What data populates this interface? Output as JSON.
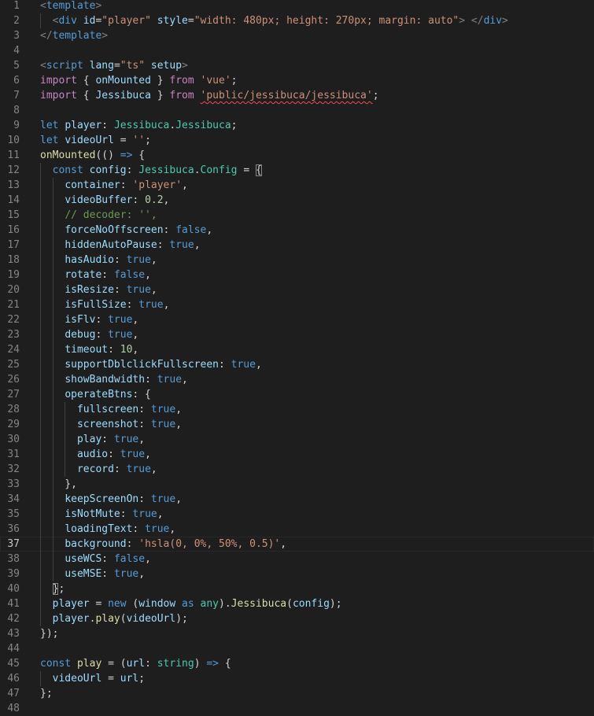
{
  "editor": {
    "current_line": 37,
    "colors": {
      "background": "#1e1e1e",
      "line_number": "#858585",
      "keyword": "#569cd6",
      "control": "#c586c0",
      "function": "#dcdcaa",
      "type": "#4ec9b0",
      "variable": "#9cdcfe",
      "string": "#ce9178",
      "number": "#b5cea8",
      "comment": "#6a9955"
    },
    "lines": [
      {
        "n": "1",
        "indent": 0,
        "tokens": [
          [
            "ang",
            "<"
          ],
          [
            "tag",
            "template"
          ],
          [
            "ang",
            ">"
          ]
        ]
      },
      {
        "n": "2",
        "indent": 1,
        "tokens": [
          [
            "txt",
            "  "
          ],
          [
            "ang",
            "<"
          ],
          [
            "tag",
            "div"
          ],
          [
            "txt",
            " "
          ],
          [
            "attr",
            "id"
          ],
          [
            "txt",
            "="
          ],
          [
            "str",
            "\"player\""
          ],
          [
            "txt",
            " "
          ],
          [
            "attr",
            "style"
          ],
          [
            "txt",
            "="
          ],
          [
            "str",
            "\"width: 480px; height: 270px; margin: auto\""
          ],
          [
            "ang",
            ">"
          ],
          [
            "txt",
            " "
          ],
          [
            "ang",
            "</"
          ],
          [
            "tag",
            "div"
          ],
          [
            "ang",
            ">"
          ]
        ]
      },
      {
        "n": "3",
        "indent": 0,
        "tokens": [
          [
            "ang",
            "</"
          ],
          [
            "tag",
            "template"
          ],
          [
            "ang",
            ">"
          ]
        ]
      },
      {
        "n": "4",
        "indent": 0,
        "tokens": []
      },
      {
        "n": "5",
        "indent": 0,
        "tokens": [
          [
            "ang",
            "<"
          ],
          [
            "tag",
            "script"
          ],
          [
            "txt",
            " "
          ],
          [
            "attr",
            "lang"
          ],
          [
            "txt",
            "="
          ],
          [
            "str",
            "\"ts\""
          ],
          [
            "txt",
            " "
          ],
          [
            "attr",
            "setup"
          ],
          [
            "ang",
            ">"
          ]
        ]
      },
      {
        "n": "6",
        "indent": 0,
        "tokens": [
          [
            "ctl",
            "import"
          ],
          [
            "txt",
            " { "
          ],
          [
            "var",
            "onMounted"
          ],
          [
            "txt",
            " } "
          ],
          [
            "ctl",
            "from"
          ],
          [
            "txt",
            " "
          ],
          [
            "str",
            "'vue'"
          ],
          [
            "txt",
            ";"
          ]
        ]
      },
      {
        "n": "7",
        "indent": 0,
        "tokens": [
          [
            "ctl",
            "import"
          ],
          [
            "txt",
            " { "
          ],
          [
            "var",
            "Jessibuca"
          ],
          [
            "txt",
            " } "
          ],
          [
            "ctl",
            "from"
          ],
          [
            "txt",
            " "
          ],
          [
            "strsq",
            "'public/jessibuca/jessibuca'"
          ],
          [
            "txt",
            ";"
          ]
        ]
      },
      {
        "n": "8",
        "indent": 0,
        "tokens": []
      },
      {
        "n": "9",
        "indent": 0,
        "tokens": [
          [
            "kw",
            "let"
          ],
          [
            "txt",
            " "
          ],
          [
            "var",
            "player"
          ],
          [
            "txt",
            ": "
          ],
          [
            "type",
            "Jessibuca"
          ],
          [
            "txt",
            "."
          ],
          [
            "type",
            "Jessibuca"
          ],
          [
            "txt",
            ";"
          ]
        ]
      },
      {
        "n": "10",
        "indent": 0,
        "tokens": [
          [
            "kw",
            "let"
          ],
          [
            "txt",
            " "
          ],
          [
            "var",
            "videoUrl"
          ],
          [
            "txt",
            " = "
          ],
          [
            "str",
            "''"
          ],
          [
            "txt",
            ";"
          ]
        ]
      },
      {
        "n": "11",
        "indent": 0,
        "tokens": [
          [
            "fn",
            "onMounted"
          ],
          [
            "txt",
            "(() "
          ],
          [
            "kw",
            "=>"
          ],
          [
            "txt",
            " {"
          ]
        ]
      },
      {
        "n": "12",
        "indent": 1,
        "tokens": [
          [
            "txt",
            "  "
          ],
          [
            "kw",
            "const"
          ],
          [
            "txt",
            " "
          ],
          [
            "var",
            "config"
          ],
          [
            "txt",
            ": "
          ],
          [
            "type",
            "Jessibuca"
          ],
          [
            "txt",
            "."
          ],
          [
            "type",
            "Config"
          ],
          [
            "txt",
            " = "
          ],
          [
            "bkt",
            "{"
          ]
        ]
      },
      {
        "n": "13",
        "indent": 2,
        "tokens": [
          [
            "txt",
            "    "
          ],
          [
            "var",
            "container"
          ],
          [
            "txt",
            ": "
          ],
          [
            "str",
            "'player'"
          ],
          [
            "txt",
            ","
          ]
        ]
      },
      {
        "n": "14",
        "indent": 2,
        "tokens": [
          [
            "txt",
            "    "
          ],
          [
            "var",
            "videoBuffer"
          ],
          [
            "txt",
            ": "
          ],
          [
            "num",
            "0.2"
          ],
          [
            "txt",
            ","
          ]
        ]
      },
      {
        "n": "15",
        "indent": 2,
        "tokens": [
          [
            "txt",
            "    "
          ],
          [
            "cmt",
            "// decoder: '',"
          ]
        ]
      },
      {
        "n": "16",
        "indent": 2,
        "tokens": [
          [
            "txt",
            "    "
          ],
          [
            "var",
            "forceNoOffscreen"
          ],
          [
            "txt",
            ": "
          ],
          [
            "kw",
            "false"
          ],
          [
            "txt",
            ","
          ]
        ]
      },
      {
        "n": "17",
        "indent": 2,
        "tokens": [
          [
            "txt",
            "    "
          ],
          [
            "var",
            "hiddenAutoPause"
          ],
          [
            "txt",
            ": "
          ],
          [
            "kw",
            "true"
          ],
          [
            "txt",
            ","
          ]
        ]
      },
      {
        "n": "18",
        "indent": 2,
        "tokens": [
          [
            "txt",
            "    "
          ],
          [
            "var",
            "hasAudio"
          ],
          [
            "txt",
            ": "
          ],
          [
            "kw",
            "true"
          ],
          [
            "txt",
            ","
          ]
        ]
      },
      {
        "n": "19",
        "indent": 2,
        "tokens": [
          [
            "txt",
            "    "
          ],
          [
            "var",
            "rotate"
          ],
          [
            "txt",
            ": "
          ],
          [
            "kw",
            "false"
          ],
          [
            "txt",
            ","
          ]
        ]
      },
      {
        "n": "20",
        "indent": 2,
        "tokens": [
          [
            "txt",
            "    "
          ],
          [
            "var",
            "isResize"
          ],
          [
            "txt",
            ": "
          ],
          [
            "kw",
            "true"
          ],
          [
            "txt",
            ","
          ]
        ]
      },
      {
        "n": "21",
        "indent": 2,
        "tokens": [
          [
            "txt",
            "    "
          ],
          [
            "var",
            "isFullSize"
          ],
          [
            "txt",
            ": "
          ],
          [
            "kw",
            "true"
          ],
          [
            "txt",
            ","
          ]
        ]
      },
      {
        "n": "22",
        "indent": 2,
        "tokens": [
          [
            "txt",
            "    "
          ],
          [
            "var",
            "isFlv"
          ],
          [
            "txt",
            ": "
          ],
          [
            "kw",
            "true"
          ],
          [
            "txt",
            ","
          ]
        ]
      },
      {
        "n": "23",
        "indent": 2,
        "tokens": [
          [
            "txt",
            "    "
          ],
          [
            "var",
            "debug"
          ],
          [
            "txt",
            ": "
          ],
          [
            "kw",
            "true"
          ],
          [
            "txt",
            ","
          ]
        ]
      },
      {
        "n": "24",
        "indent": 2,
        "tokens": [
          [
            "txt",
            "    "
          ],
          [
            "var",
            "timeout"
          ],
          [
            "txt",
            ": "
          ],
          [
            "num",
            "10"
          ],
          [
            "txt",
            ","
          ]
        ]
      },
      {
        "n": "25",
        "indent": 2,
        "tokens": [
          [
            "txt",
            "    "
          ],
          [
            "var",
            "supportDblclickFullscreen"
          ],
          [
            "txt",
            ": "
          ],
          [
            "kw",
            "true"
          ],
          [
            "txt",
            ","
          ]
        ]
      },
      {
        "n": "26",
        "indent": 2,
        "tokens": [
          [
            "txt",
            "    "
          ],
          [
            "var",
            "showBandwidth"
          ],
          [
            "txt",
            ": "
          ],
          [
            "kw",
            "true"
          ],
          [
            "txt",
            ","
          ]
        ]
      },
      {
        "n": "27",
        "indent": 2,
        "tokens": [
          [
            "txt",
            "    "
          ],
          [
            "var",
            "operateBtns"
          ],
          [
            "txt",
            ": {"
          ]
        ]
      },
      {
        "n": "28",
        "indent": 3,
        "tokens": [
          [
            "txt",
            "      "
          ],
          [
            "var",
            "fullscreen"
          ],
          [
            "txt",
            ": "
          ],
          [
            "kw",
            "true"
          ],
          [
            "txt",
            ","
          ]
        ]
      },
      {
        "n": "29",
        "indent": 3,
        "tokens": [
          [
            "txt",
            "      "
          ],
          [
            "var",
            "screenshot"
          ],
          [
            "txt",
            ": "
          ],
          [
            "kw",
            "true"
          ],
          [
            "txt",
            ","
          ]
        ]
      },
      {
        "n": "30",
        "indent": 3,
        "tokens": [
          [
            "txt",
            "      "
          ],
          [
            "var",
            "play"
          ],
          [
            "txt",
            ": "
          ],
          [
            "kw",
            "true"
          ],
          [
            "txt",
            ","
          ]
        ]
      },
      {
        "n": "31",
        "indent": 3,
        "tokens": [
          [
            "txt",
            "      "
          ],
          [
            "var",
            "audio"
          ],
          [
            "txt",
            ": "
          ],
          [
            "kw",
            "true"
          ],
          [
            "txt",
            ","
          ]
        ]
      },
      {
        "n": "32",
        "indent": 3,
        "tokens": [
          [
            "txt",
            "      "
          ],
          [
            "var",
            "record"
          ],
          [
            "txt",
            ": "
          ],
          [
            "kw",
            "true"
          ],
          [
            "txt",
            ","
          ]
        ]
      },
      {
        "n": "33",
        "indent": 2,
        "tokens": [
          [
            "txt",
            "    },"
          ]
        ]
      },
      {
        "n": "34",
        "indent": 2,
        "tokens": [
          [
            "txt",
            "    "
          ],
          [
            "var",
            "keepScreenOn"
          ],
          [
            "txt",
            ": "
          ],
          [
            "kw",
            "true"
          ],
          [
            "txt",
            ","
          ]
        ]
      },
      {
        "n": "35",
        "indent": 2,
        "tokens": [
          [
            "txt",
            "    "
          ],
          [
            "var",
            "isNotMute"
          ],
          [
            "txt",
            ": "
          ],
          [
            "kw",
            "true"
          ],
          [
            "txt",
            ","
          ]
        ]
      },
      {
        "n": "36",
        "indent": 2,
        "tokens": [
          [
            "txt",
            "    "
          ],
          [
            "var",
            "loadingText"
          ],
          [
            "txt",
            ": "
          ],
          [
            "kw",
            "true"
          ],
          [
            "txt",
            ","
          ]
        ]
      },
      {
        "n": "37",
        "indent": 2,
        "tokens": [
          [
            "txt",
            "    "
          ],
          [
            "var",
            "background"
          ],
          [
            "txt",
            ": "
          ],
          [
            "str",
            "'hsla(0, 0%, 50%, 0.5)'"
          ],
          [
            "txt",
            ","
          ]
        ]
      },
      {
        "n": "38",
        "indent": 2,
        "tokens": [
          [
            "txt",
            "    "
          ],
          [
            "var",
            "useWCS"
          ],
          [
            "txt",
            ": "
          ],
          [
            "kw",
            "false"
          ],
          [
            "txt",
            ","
          ]
        ]
      },
      {
        "n": "39",
        "indent": 2,
        "tokens": [
          [
            "txt",
            "    "
          ],
          [
            "var",
            "useMSE"
          ],
          [
            "txt",
            ": "
          ],
          [
            "kw",
            "true"
          ],
          [
            "txt",
            ","
          ]
        ]
      },
      {
        "n": "40",
        "indent": 1,
        "tokens": [
          [
            "txt",
            "  "
          ],
          [
            "bkt",
            "}"
          ],
          [
            "txt",
            ";"
          ]
        ]
      },
      {
        "n": "41",
        "indent": 1,
        "tokens": [
          [
            "txt",
            "  "
          ],
          [
            "var",
            "player"
          ],
          [
            "txt",
            " = "
          ],
          [
            "kw",
            "new"
          ],
          [
            "txt",
            " ("
          ],
          [
            "var",
            "window"
          ],
          [
            "txt",
            " "
          ],
          [
            "kw",
            "as"
          ],
          [
            "txt",
            " "
          ],
          [
            "type",
            "any"
          ],
          [
            "txt",
            ")."
          ],
          [
            "fn",
            "Jessibuca"
          ],
          [
            "txt",
            "("
          ],
          [
            "var",
            "config"
          ],
          [
            "txt",
            ");"
          ]
        ]
      },
      {
        "n": "42",
        "indent": 1,
        "tokens": [
          [
            "txt",
            "  "
          ],
          [
            "var",
            "player"
          ],
          [
            "txt",
            "."
          ],
          [
            "fn",
            "play"
          ],
          [
            "txt",
            "("
          ],
          [
            "var",
            "videoUrl"
          ],
          [
            "txt",
            ");"
          ]
        ]
      },
      {
        "n": "43",
        "indent": 0,
        "tokens": [
          [
            "txt",
            "});"
          ]
        ]
      },
      {
        "n": "44",
        "indent": 0,
        "tokens": []
      },
      {
        "n": "45",
        "indent": 0,
        "tokens": [
          [
            "kw",
            "const"
          ],
          [
            "txt",
            " "
          ],
          [
            "fn",
            "play"
          ],
          [
            "txt",
            " = ("
          ],
          [
            "var",
            "url"
          ],
          [
            "txt",
            ": "
          ],
          [
            "type",
            "string"
          ],
          [
            "txt",
            ") "
          ],
          [
            "kw",
            "=>"
          ],
          [
            "txt",
            " {"
          ]
        ]
      },
      {
        "n": "46",
        "indent": 1,
        "tokens": [
          [
            "txt",
            "  "
          ],
          [
            "var",
            "videoUrl"
          ],
          [
            "txt",
            " = "
          ],
          [
            "var",
            "url"
          ],
          [
            "txt",
            ";"
          ]
        ]
      },
      {
        "n": "47",
        "indent": 0,
        "tokens": [
          [
            "txt",
            "};"
          ]
        ]
      },
      {
        "n": "48",
        "indent": 0,
        "tokens": []
      }
    ]
  }
}
